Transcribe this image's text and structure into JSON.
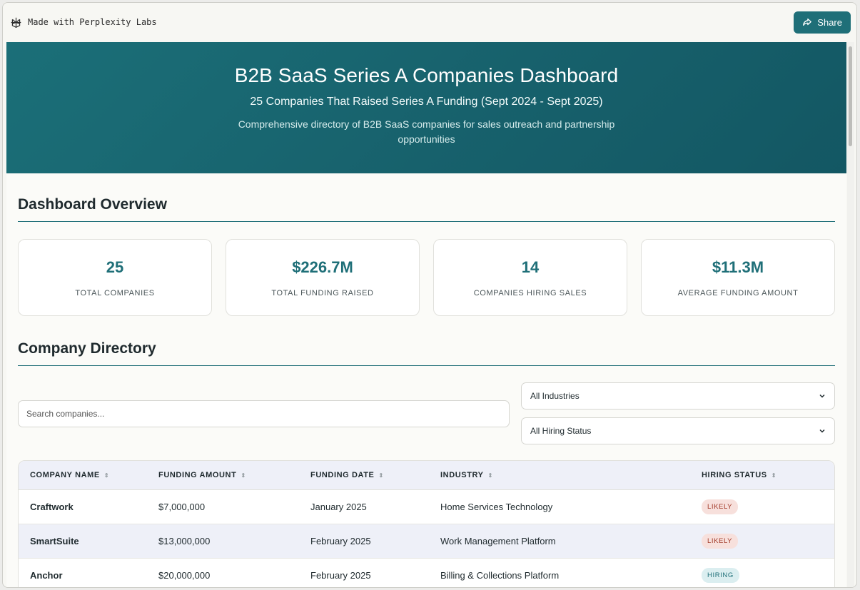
{
  "topbar": {
    "brand_text": "Made with Perplexity Labs",
    "share_label": "Share"
  },
  "hero": {
    "title": "B2B SaaS Series A Companies Dashboard",
    "subtitle": "25 Companies That Raised Series A Funding (Sept 2024 - Sept 2025)",
    "description": "Comprehensive directory of B2B SaaS companies for sales outreach and partnership opportunities"
  },
  "overview": {
    "title": "Dashboard Overview",
    "stats": [
      {
        "value": "25",
        "label": "TOTAL COMPANIES"
      },
      {
        "value": "$226.7M",
        "label": "TOTAL FUNDING RAISED"
      },
      {
        "value": "14",
        "label": "COMPANIES HIRING SALES"
      },
      {
        "value": "$11.3M",
        "label": "AVERAGE FUNDING AMOUNT"
      }
    ]
  },
  "directory": {
    "title": "Company Directory",
    "search_placeholder": "Search companies...",
    "industry_filter": "All Industries",
    "hiring_filter": "All Hiring Status",
    "columns": [
      "COMPANY NAME",
      "FUNDING AMOUNT",
      "FUNDING DATE",
      "INDUSTRY",
      "HIRING STATUS"
    ],
    "rows": [
      {
        "name": "Craftwork",
        "amount": "$7,000,000",
        "date": "January 2025",
        "industry": "Home Services Technology",
        "status": "LIKELY"
      },
      {
        "name": "SmartSuite",
        "amount": "$13,000,000",
        "date": "February 2025",
        "industry": "Work Management Platform",
        "status": "LIKELY"
      },
      {
        "name": "Anchor",
        "amount": "$20,000,000",
        "date": "February 2025",
        "industry": "Billing & Collections Platform",
        "status": "HIRING"
      }
    ]
  },
  "colors": {
    "accent": "#1f6f78",
    "likely_badge": "#f7e0dc",
    "hiring_badge": "#dbeef0"
  }
}
